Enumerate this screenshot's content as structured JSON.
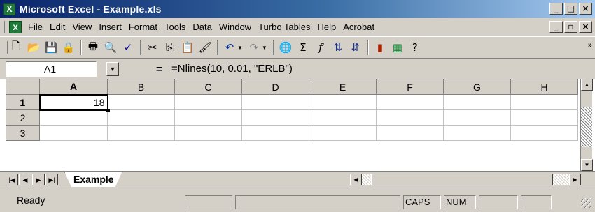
{
  "window": {
    "title": "Microsoft Excel - Example.xls",
    "buttons": [
      "_",
      "□",
      "×"
    ]
  },
  "menu": {
    "items": [
      "File",
      "Edit",
      "View",
      "Insert",
      "Format",
      "Tools",
      "Data",
      "Window",
      "Turbo Tables",
      "Help",
      "Acrobat"
    ],
    "doc_buttons": [
      "_",
      "▫",
      "×"
    ]
  },
  "toolbar": {
    "icons": [
      "new-icon",
      "open-icon",
      "save-icon",
      "permission-icon",
      "print-icon",
      "print-preview-icon",
      "spelling-icon",
      "cut-icon",
      "copy-icon",
      "paste-icon",
      "format-painter-icon",
      "undo-icon",
      "redo-icon",
      "web-icon",
      "autosum-icon",
      "function-icon",
      "sort-ascending-icon",
      "sort-descending-icon",
      "chart-wizard-icon",
      "map-icon",
      "help-icon"
    ]
  },
  "formula_bar": {
    "name_box": "A1",
    "equals": "=",
    "formula": "=Nlines(10, 0.01, \"ERLB\")"
  },
  "grid": {
    "columns": [
      "A",
      "B",
      "C",
      "D",
      "E",
      "F",
      "G",
      "H"
    ],
    "rows": [
      "1",
      "2",
      "3"
    ],
    "cell_A1": "18"
  },
  "sheets": {
    "active": "Example"
  },
  "status": {
    "text": "Ready",
    "caps": "CAPS",
    "num": "NUM"
  }
}
